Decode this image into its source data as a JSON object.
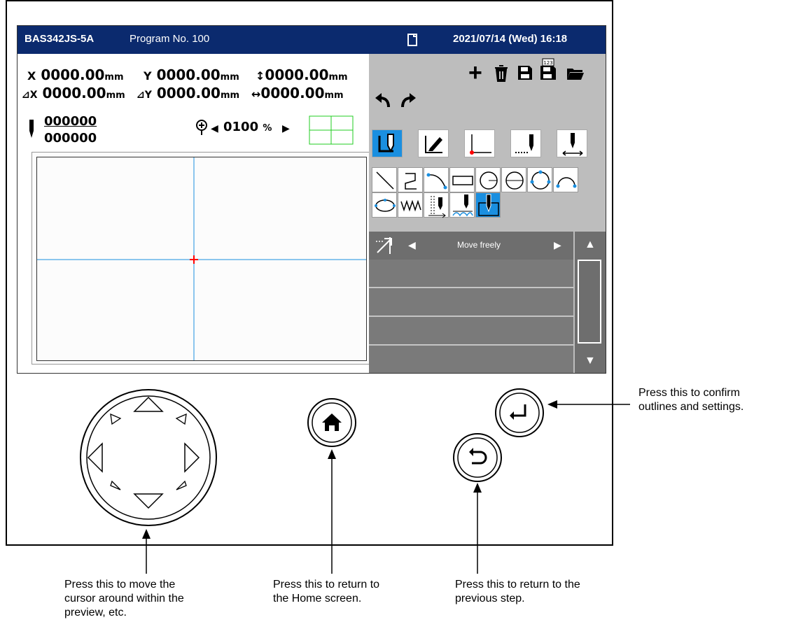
{
  "titlebar": {
    "model": "BAS342JS-5A",
    "program": "Program No. 100",
    "datetime": "2021/07/14 (Wed) 16:18"
  },
  "coordinates": {
    "x_label": "X",
    "x_value": "0000.00",
    "y_label": "Y",
    "y_value": "0000.00",
    "vertical_value": "0000.00",
    "dx_label": "⊿X",
    "dx_value": "0000.00",
    "dy_label": "⊿Y",
    "dy_value": "0000.00",
    "horizontal_value": "0000.00",
    "unit": "mm"
  },
  "stitch_counter": {
    "current": "000000",
    "total": "000000"
  },
  "zoom": {
    "value": "0100",
    "unit": "%"
  },
  "mode_selector": {
    "label": "Move freely"
  },
  "captions": {
    "confirm": [
      "Press this to confirm",
      "outlines and settings."
    ],
    "cursor": [
      "Press this to move the",
      "cursor around within the",
      "preview, etc."
    ],
    "home": [
      "Press this to return to",
      "the Home screen."
    ],
    "back": [
      "Press this to return to the",
      "previous step."
    ]
  },
  "colors": {
    "title_bar": "#0b2a6e",
    "selected_tool": "#1a8fe0",
    "crosshair": "#1a8fe0",
    "origin_marker": "#ff0000",
    "grid_icon": "#22cc22"
  }
}
